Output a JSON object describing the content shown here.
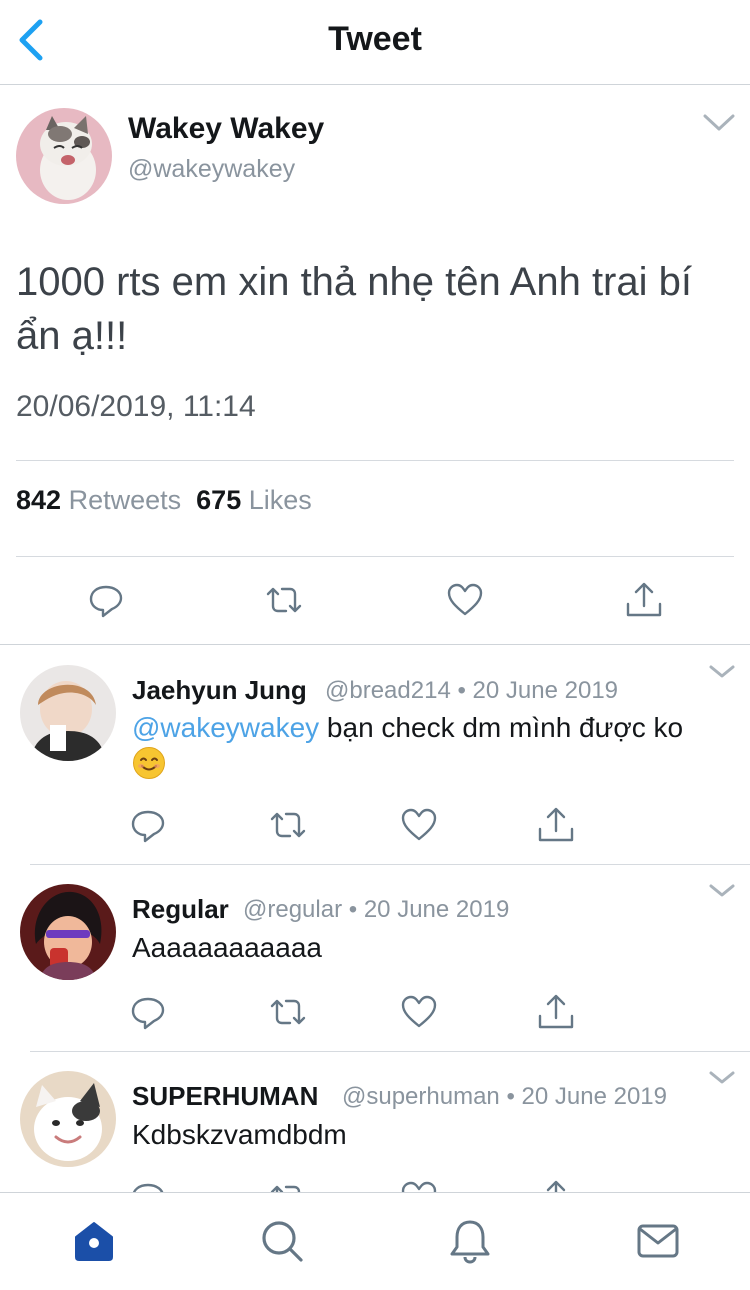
{
  "header": {
    "title": "Tweet"
  },
  "tweet": {
    "name": "Wakey Wakey",
    "handle": "@wakeywakey",
    "text": "1000 rts em xin thả nhẹ tên Anh trai bí ẩn ạ!!!",
    "timestamp": "20/06/2019, 11:14",
    "retweets_count": "842",
    "retweets_label": "Retweets",
    "likes_count": "675",
    "likes_label": "Likes"
  },
  "replies": [
    {
      "name": "Jaehyun Jung",
      "handle": "@bread214",
      "date": "20 June 2019",
      "mention": "@wakeywakey",
      "text": " bạn check dm mình được ko ",
      "emoji": "smiling-face"
    },
    {
      "name": "Regular",
      "handle": "@regular",
      "date": "20 June 2019",
      "text": "Aaaaaaaaaaaa"
    },
    {
      "name": "SUPERHUMAN",
      "handle": "@superhuman",
      "date": "20 June 2019",
      "text": "Kdbskzvamdbdm"
    }
  ],
  "meta_separator": "•",
  "colors": {
    "accent": "#1da1f2",
    "nav_active": "#1b4fa8",
    "mention": "#4da3e6",
    "muted": "#8a949e"
  },
  "icons": [
    "chevron-left",
    "chevron-down",
    "reply",
    "retweet",
    "like",
    "share",
    "home",
    "search",
    "bell",
    "mail"
  ]
}
